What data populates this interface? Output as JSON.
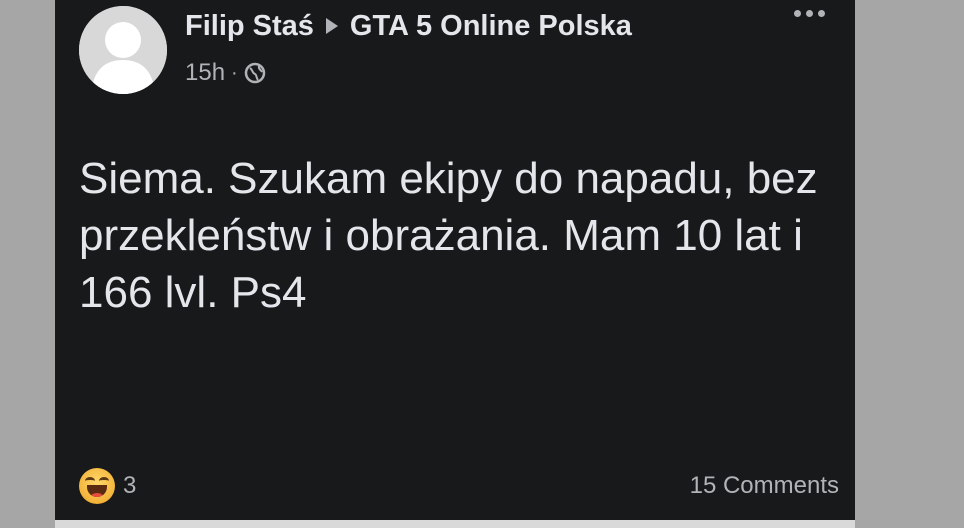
{
  "post": {
    "author": "Filip Staś",
    "group": "GTA 5 Online Polska",
    "time": "15h",
    "separator": "·",
    "body": "Siema. Szukam ekipy do napadu, bez przekleństw i obrażania. Mam 10 lat i 166 lvl. Ps4",
    "reaction_count": "3",
    "comments_label": "15 Comments"
  },
  "icons": {
    "reaction": "haha-reaction-icon",
    "privacy": "globe-icon",
    "menu": "more-options-icon",
    "share_arrow": "arrow-right-icon"
  },
  "colors": {
    "post_background": "#18191a",
    "primary_text": "#e4e6eb",
    "secondary_text": "#b0b3b8"
  }
}
